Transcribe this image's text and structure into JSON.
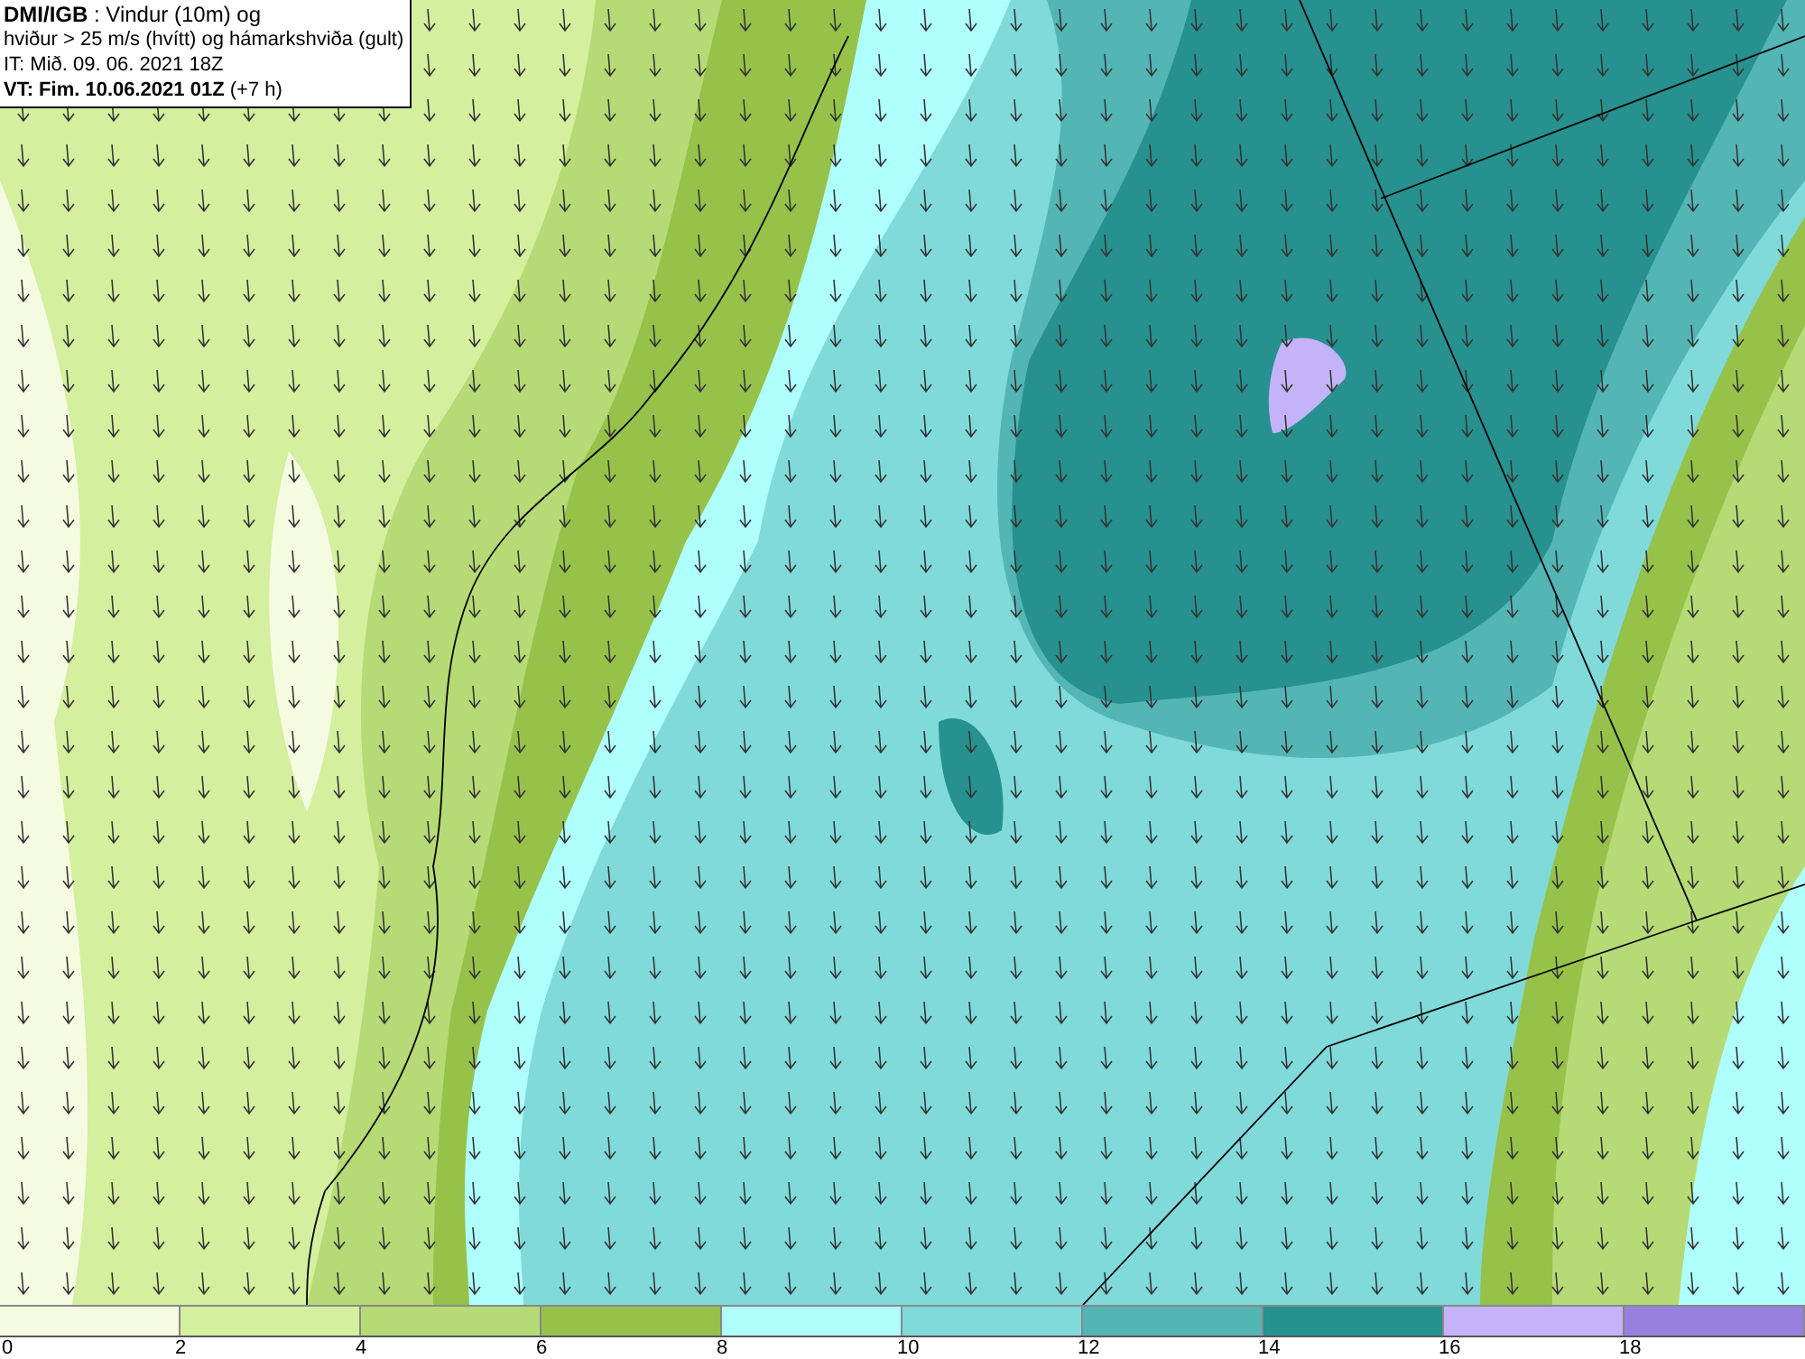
{
  "title_box": {
    "lines": [
      "**DMI/IGB** : Vindur (10m) og",
      "hviður > 25 m/s (hvítt) og hámarkshviða (gult)",
      "IT: Mið. 09. 06. 2021 18Z",
      "**VT: Fim. 10.06.2021 01Z** (+7 h)"
    ]
  },
  "legend": {
    "segments": [
      {
        "color": "#f5fbe0"
      },
      {
        "color": "#d4ef9e"
      },
      {
        "color": "#b6da75"
      },
      {
        "color": "#96c24a"
      },
      {
        "color": "#b0ffff"
      },
      {
        "color": "#80dada"
      },
      {
        "color": "#54b5b5"
      },
      {
        "color": "#26918e"
      },
      {
        "color": "#c4b3f9"
      },
      {
        "color": "#9880e0"
      }
    ],
    "ticks": [
      "0",
      "2",
      "4",
      "6",
      "8",
      "10",
      "12",
      "14",
      "16",
      "18"
    ]
  }
}
